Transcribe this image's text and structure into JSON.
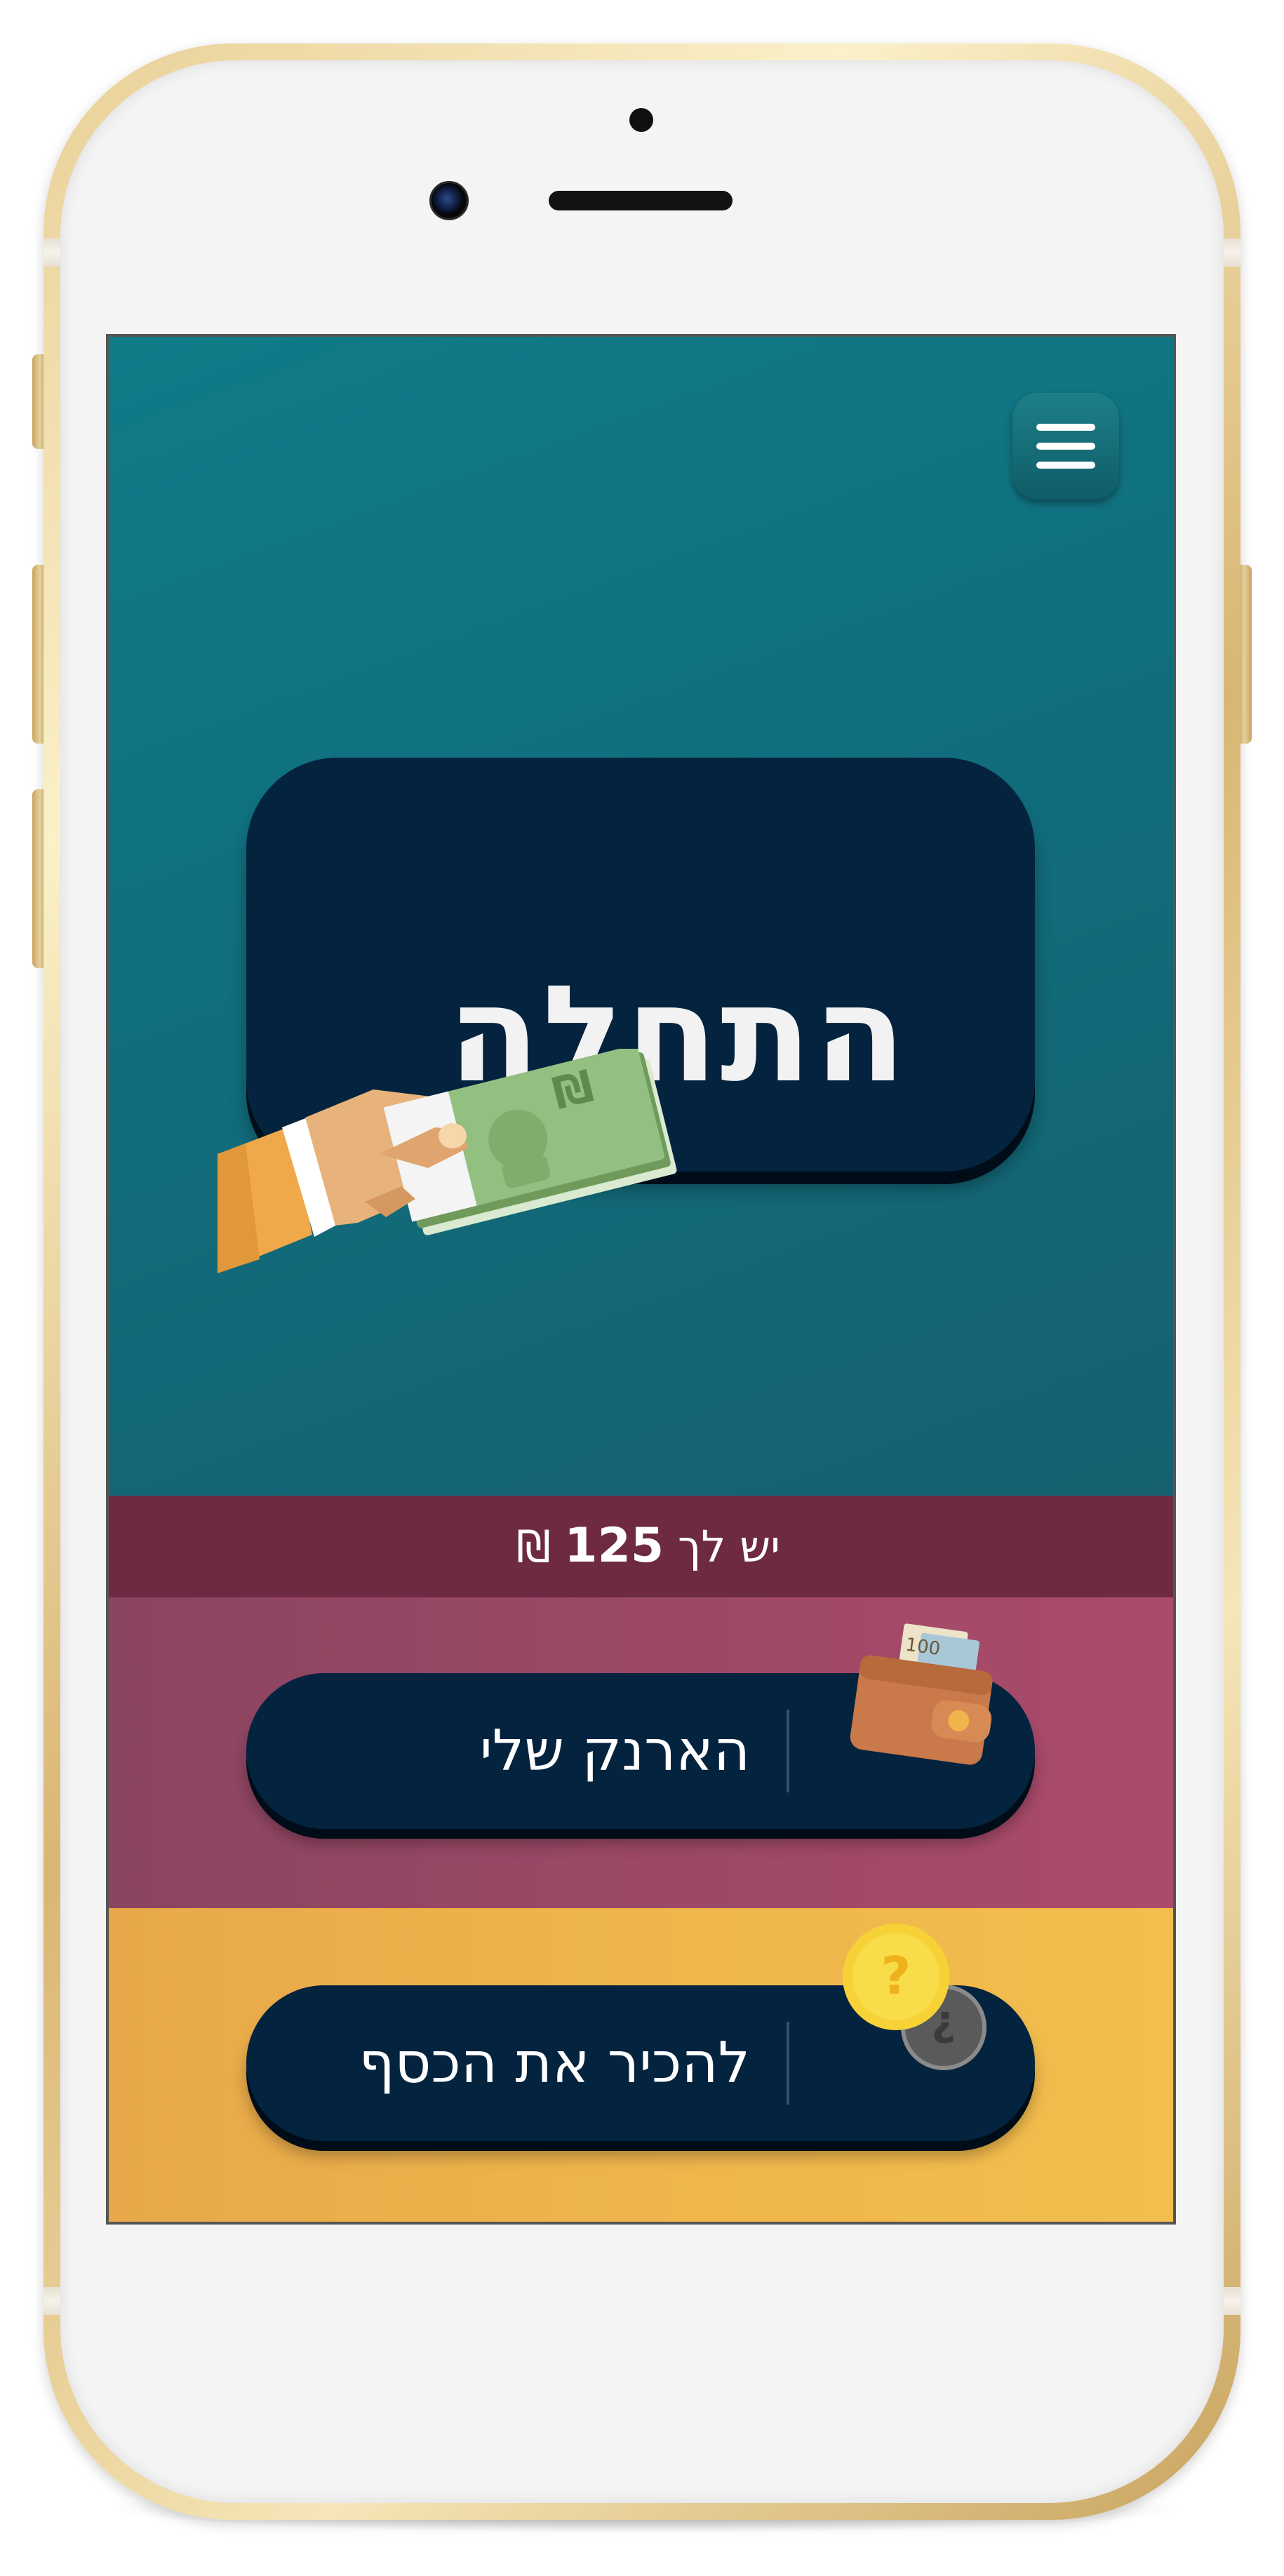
{
  "app": {
    "menu_icon": "hamburger-menu-icon",
    "start": {
      "label": "התחלה",
      "illustration_icon": "hand-holding-banknote-icon",
      "banknote_symbol": "₪"
    },
    "balance": {
      "prefix": "יש לך",
      "amount": "125",
      "currency": "₪"
    },
    "wallet": {
      "label": "הארנק שלי",
      "icon": "wallet-icon",
      "banknote_value": "100"
    },
    "know_money": {
      "label": "להכיר את הכסף",
      "icon": "coins-question-icon",
      "mark": "?"
    }
  },
  "colors": {
    "top_section": "#107485",
    "button_navy": "#04233f",
    "balance_strip": "#6e2a43",
    "wallet_section": "#9c4866",
    "money_section": "#efb54c",
    "phone_gold": "#e3c382"
  }
}
